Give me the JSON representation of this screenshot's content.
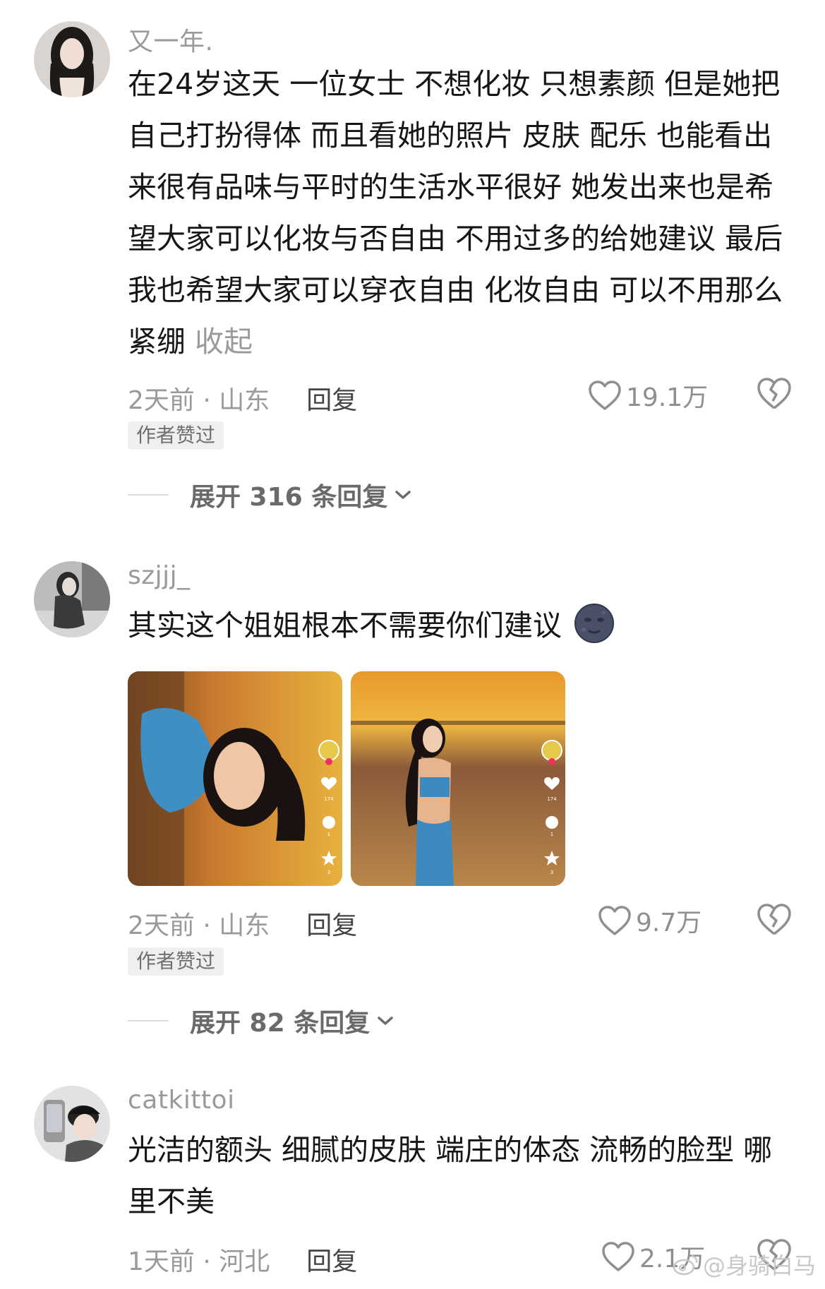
{
  "comments": [
    {
      "username": "又一年.",
      "text": "在24岁这天 一位女士 不想化妆 只想素颜 但是她把自己打扮得体 而且看她的照片 皮肤 配乐 也能看出来很有品味与平时的生活水平很好 她发出来也是希望大家可以化妆与否自由 不用过多的给她建议 最后我也希望大家可以穿衣自由 化妆自由 可以不用那么紧绷",
      "collapse_label": "收起",
      "meta": "2天前 · 山东",
      "reply_label": "回复",
      "likes": "19.1万",
      "badge": "作者赞过",
      "expand_label": "展开 316 条回复"
    },
    {
      "username": "szjjj_",
      "text": "其实这个姐姐根本不需要你们建议",
      "meta": "2天前 · 山东",
      "reply_label": "回复",
      "likes": "9.7万",
      "badge": "作者赞过",
      "expand_label": "展开 82 条回复",
      "image_stats": [
        {
          "likes": "174",
          "comments": "1",
          "stars": "3"
        },
        {
          "likes": "174",
          "comments": "1",
          "stars": "3"
        }
      ]
    },
    {
      "username": "catkittoi",
      "text": "光洁的额头 细腻的皮肤 端庄的体态 流畅的脸型 哪里不美",
      "meta": "1天前 · 河北",
      "reply_label": "回复",
      "likes": "2.1万"
    }
  ],
  "watermark": "@身骑白马"
}
